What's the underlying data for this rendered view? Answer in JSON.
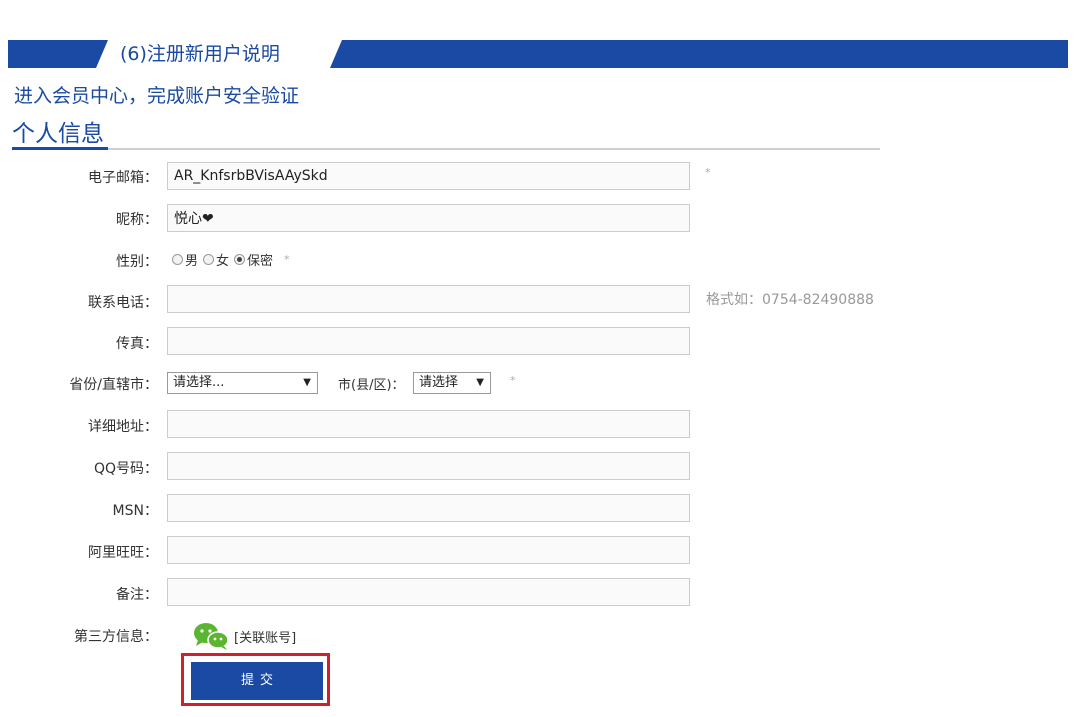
{
  "header": {
    "banner_title": "(6)注册新用户说明",
    "intro": "进入会员中心，完成账户安全验证",
    "section_title": "个人信息"
  },
  "colors": {
    "brand_blue": "#1a4aa3",
    "highlight_red": "#d0202d"
  },
  "form": {
    "email": {
      "label": "电子邮箱：",
      "value": "AR_KnfsrbBVisAAySkd",
      "required_mark": "*"
    },
    "nickname": {
      "label": "昵称：",
      "value": "悦心❤"
    },
    "gender": {
      "label": "性别：",
      "options": [
        "男",
        "女",
        "保密"
      ],
      "selected": "保密",
      "required_mark": "*"
    },
    "phone": {
      "label": "联系电话：",
      "value": "",
      "hint": "格式如：0754-82490888"
    },
    "fax": {
      "label": "传真：",
      "value": ""
    },
    "province": {
      "label": "省份/直辖市：",
      "selected": "请选择..."
    },
    "city": {
      "label": "市(县/区)：",
      "selected": "请选择",
      "required_mark": "*"
    },
    "address": {
      "label": "详细地址：",
      "value": ""
    },
    "qq": {
      "label": "QQ号码：",
      "value": ""
    },
    "msn": {
      "label": "MSN：",
      "value": ""
    },
    "aliwangwang": {
      "label": "阿里旺旺：",
      "value": ""
    },
    "remark": {
      "label": "备注：",
      "value": ""
    },
    "third_party": {
      "label": "第三方信息：",
      "icon": "wechat-icon",
      "link_text": "[关联账号]"
    },
    "submit_label": "提交"
  }
}
